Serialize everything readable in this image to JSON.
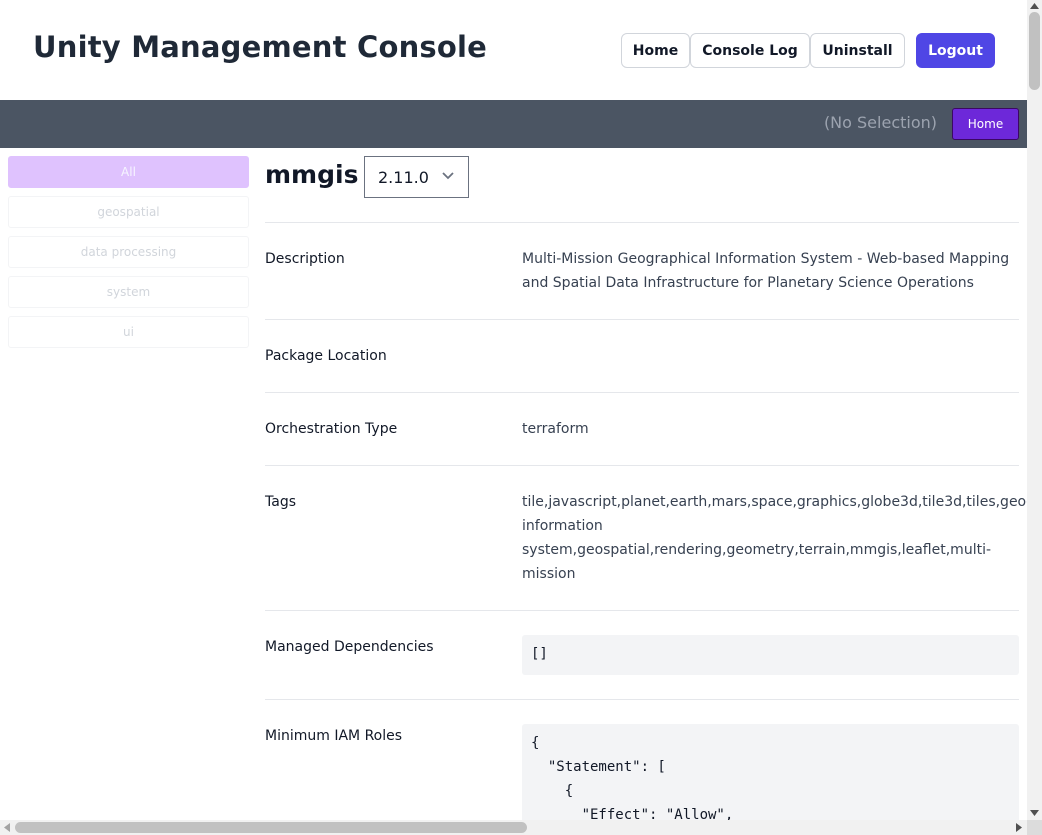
{
  "header": {
    "title": "Unity Management Console",
    "nav": {
      "home": "Home",
      "console_log": "Console Log",
      "uninstall": "Uninstall",
      "logout": "Logout"
    }
  },
  "selection_bar": {
    "status": "(No Selection)",
    "home": "Home"
  },
  "sidebar": {
    "items": [
      {
        "label": "All",
        "active": true
      },
      {
        "label": "geospatial"
      },
      {
        "label": "data processing"
      },
      {
        "label": "system"
      },
      {
        "label": "ui"
      }
    ]
  },
  "package": {
    "name": "mmgis",
    "version": "2.11.0",
    "fields": {
      "description": {
        "label": "Description",
        "lines": [
          "Multi-Mission Geographical Information System - Web-based Mapping",
          "and Spatial Data Infrastructure for Planetary Science Operations"
        ]
      },
      "package_location": {
        "label": "Package Location",
        "value": ""
      },
      "orchestration_type": {
        "label": "Orchestration Type",
        "value": "terraform"
      },
      "tags": {
        "label": "Tags",
        "lines": [
          "tile,javascript,planet,earth,mars,space,graphics,globe3d,tile3d,tiles,geog",
          "information",
          "system,geospatial,rendering,geometry,terrain,mmgis,leaflet,multi-",
          "mission"
        ]
      },
      "managed_dependencies": {
        "label": "Managed Dependencies",
        "value": "[]"
      },
      "minimum_iam_roles": {
        "label": "Minimum IAM Roles",
        "lines": [
          "{",
          "  \"Statement\": [",
          "    {",
          "      \"Effect\": \"Allow\","
        ]
      }
    }
  },
  "colors": {
    "accent": "#4f46e5",
    "selbar": "#4b5563",
    "sidebar_active": "#d8b4fe",
    "selbar_home": "#6d28d9"
  },
  "icons": {
    "version_dropdown": "chevron-down-icon"
  }
}
